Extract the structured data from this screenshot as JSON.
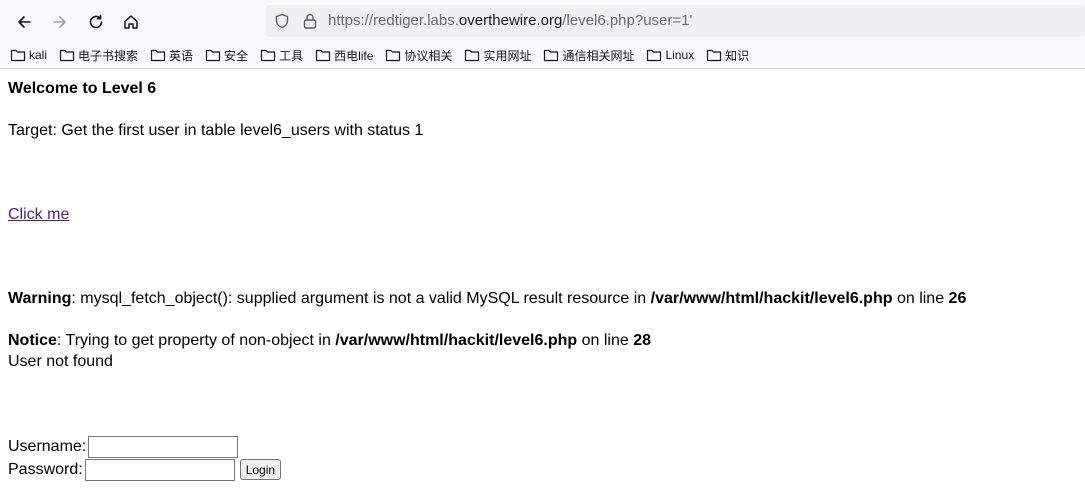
{
  "browser": {
    "url_prefix": "https://redtiger.labs.",
    "url_domain": "overthewire.org",
    "url_suffix": "/level6.php?user=1'",
    "bookmarks": [
      "kali",
      "电子书搜索",
      "英语",
      "安全",
      "工具",
      "西电life",
      "协议相关",
      "实用网址",
      "通信相关网址",
      "Linux",
      "知识"
    ]
  },
  "page": {
    "heading": "Welcome to Level 6",
    "target": "Target: Get the first user in table level6_users with status 1",
    "link_label": "Click me",
    "warning": {
      "label": "Warning",
      "text": ": mysql_fetch_object(): supplied argument is not a valid MySQL result resource in ",
      "path": "/var/www/html/hackit/level6.php",
      "on_line": " on line ",
      "line": "26"
    },
    "notice": {
      "label": "Notice",
      "text": ": Trying to get property of non-object in ",
      "path": "/var/www/html/hackit/level6.php",
      "on_line": " on line ",
      "line": "28"
    },
    "not_found": "User not found",
    "form": {
      "username_label": "Username:",
      "username_value": "",
      "password_label": "Password:",
      "password_value": "",
      "login_label": "Login"
    }
  }
}
